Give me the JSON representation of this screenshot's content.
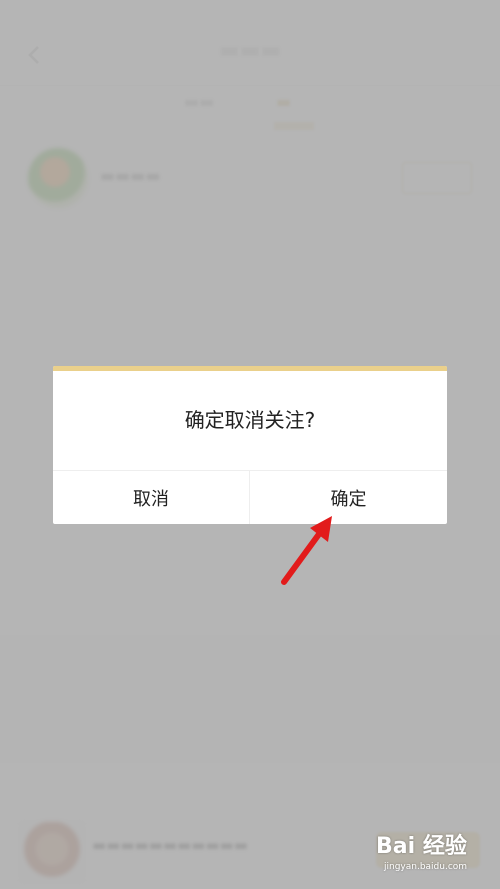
{
  "dialog": {
    "message": "确定取消关注?",
    "cancel_label": "取消",
    "confirm_label": "确定",
    "accent_color": "#ead08b"
  },
  "annotation": {
    "arrow_color": "#e21b1b",
    "points_to": "confirm-button"
  },
  "watermark": {
    "main": "Bai 经验",
    "sub": "jingyan.baidu.com"
  }
}
